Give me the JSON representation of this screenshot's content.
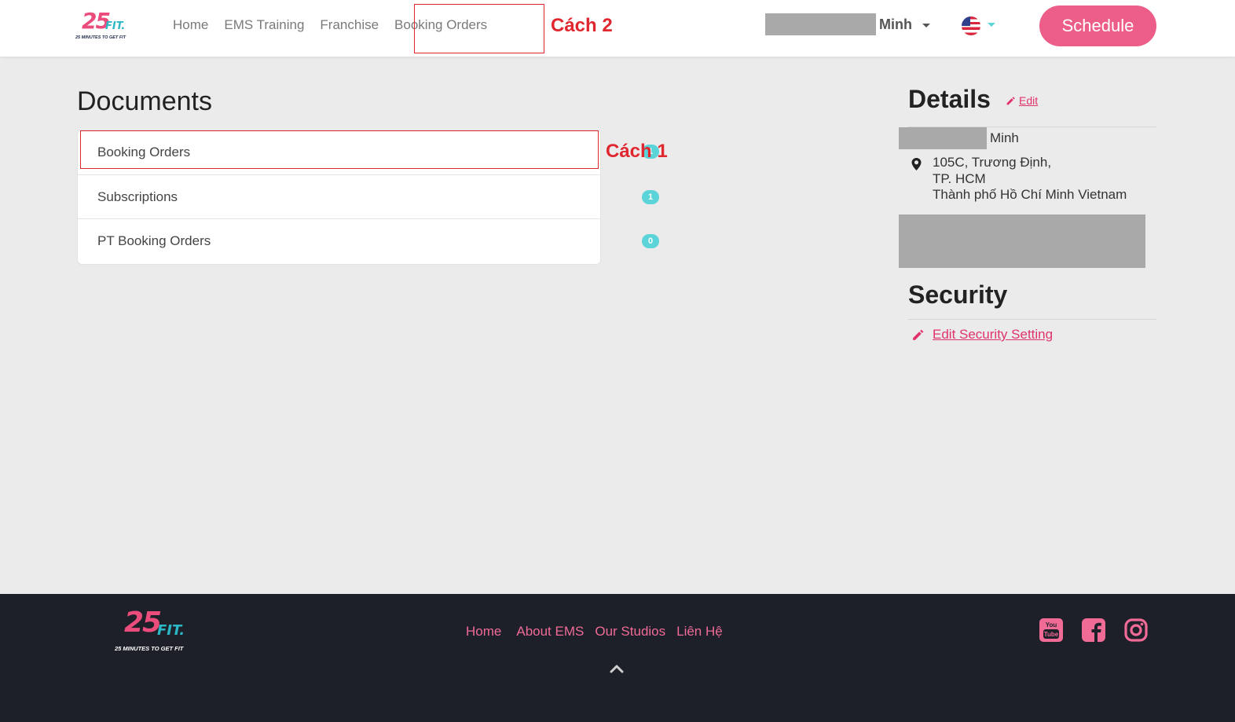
{
  "brand": {
    "logo_main": "25",
    "logo_fit": "FIT.",
    "logo_tagline": "25 MINUTES TO GET FIT",
    "primary_color": "#ec5d87",
    "accent_color": "#5ad4d8"
  },
  "header": {
    "nav": [
      {
        "label": "Home"
      },
      {
        "label": "EMS Training"
      },
      {
        "label": "Franchise"
      },
      {
        "label": "Booking Orders"
      }
    ],
    "annotation_2": "Cách 2",
    "user_name": "Minh",
    "language_icon": "us-flag-icon",
    "schedule_label": "Schedule"
  },
  "documents": {
    "title": "Documents",
    "items": [
      {
        "label": "Booking Orders",
        "count": "1"
      },
      {
        "label": "Subscriptions",
        "count": "1"
      },
      {
        "label": "PT Booking Orders",
        "count": "0"
      }
    ],
    "annotation_1": "Cách 1"
  },
  "details": {
    "title": "Details",
    "edit_label": "Edit",
    "name": "Minh",
    "address_line1": "105C, Trương Định,",
    "address_line2": "TP. HCM",
    "address_line3": "Thành phố Hồ Chí Minh Vietnam"
  },
  "security": {
    "title": "Security",
    "edit_label": "Edit Security Setting"
  },
  "footer": {
    "links": [
      {
        "label": "Home"
      },
      {
        "label": "About EMS"
      },
      {
        "label": "Our Studios"
      },
      {
        "label": "Liên Hệ"
      }
    ],
    "social": [
      "youtube-icon",
      "facebook-icon",
      "instagram-icon"
    ]
  }
}
